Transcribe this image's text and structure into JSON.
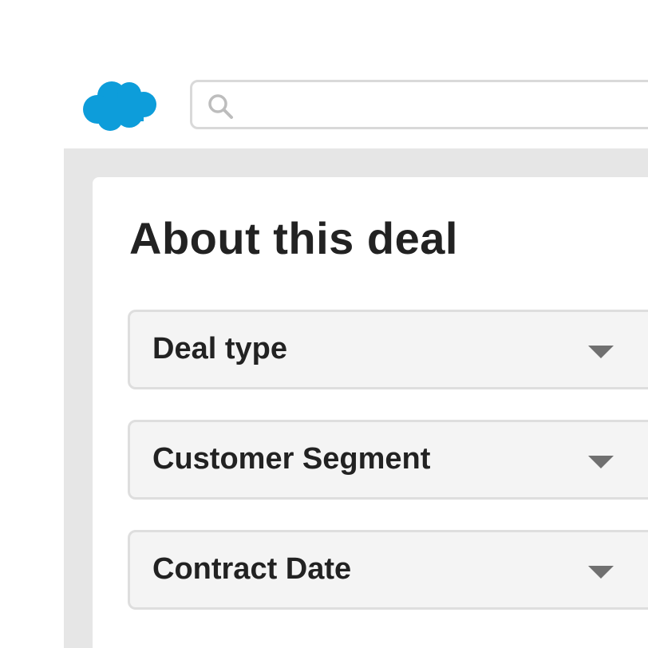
{
  "header": {
    "logo": {
      "icon": "cloud-logo-icon",
      "color": "#0d9dda"
    },
    "search": {
      "icon": "search-icon",
      "value": "",
      "placeholder": ""
    }
  },
  "card": {
    "title": "About this deal",
    "dropdowns": [
      {
        "label": "Deal type",
        "icon": "chevron-down-icon"
      },
      {
        "label": "Customer Segment",
        "icon": "chevron-down-icon"
      },
      {
        "label": "Contract Date",
        "icon": "chevron-down-icon"
      }
    ]
  },
  "colors": {
    "brand": "#0d9dda",
    "text": "#222222",
    "field_bg": "#f4f4f4",
    "field_border": "#dedede",
    "panel_bg": "#e6e6e6",
    "chevron": "#707070"
  }
}
